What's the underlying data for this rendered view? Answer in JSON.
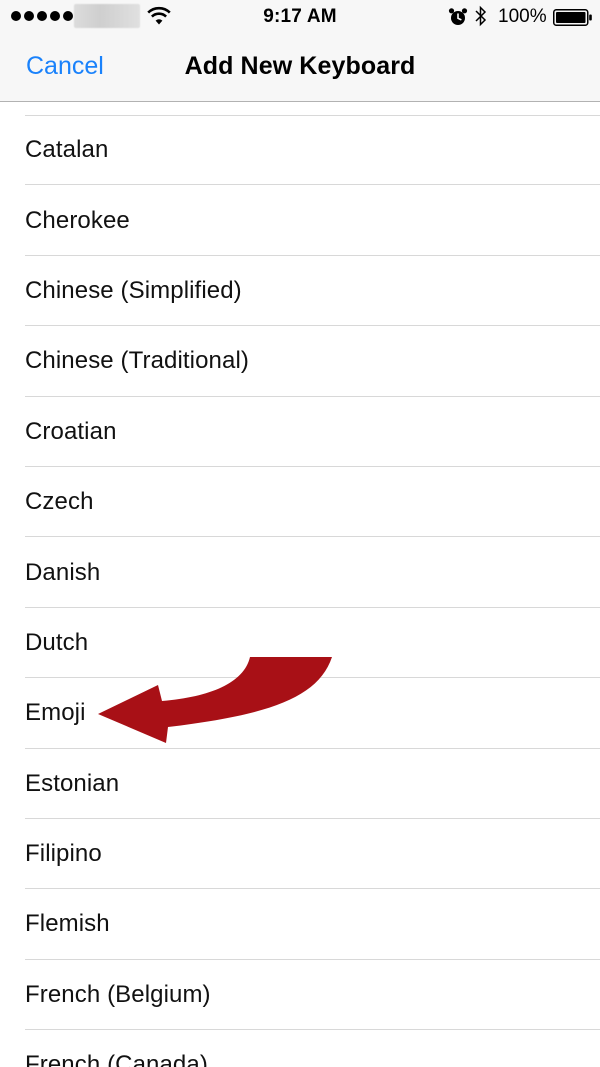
{
  "status_bar": {
    "time": "9:17 AM",
    "battery_percent": "100%",
    "signal_bars": 5,
    "icons": [
      "wifi-icon",
      "alarm-icon",
      "bluetooth-icon",
      "battery-icon"
    ]
  },
  "nav": {
    "cancel_label": "Cancel",
    "title": "Add New Keyboard"
  },
  "colors": {
    "accent": "#1a82fb",
    "annotation_arrow": "#a81016"
  },
  "keyboards": [
    "Catalan",
    "Cherokee",
    "Chinese (Simplified)",
    "Chinese (Traditional)",
    "Croatian",
    "Czech",
    "Danish",
    "Dutch",
    "Emoji",
    "Estonian",
    "Filipino",
    "Flemish",
    "French (Belgium)",
    "French (Canada)"
  ],
  "annotation": {
    "type": "arrow",
    "points_to": "Emoji"
  }
}
